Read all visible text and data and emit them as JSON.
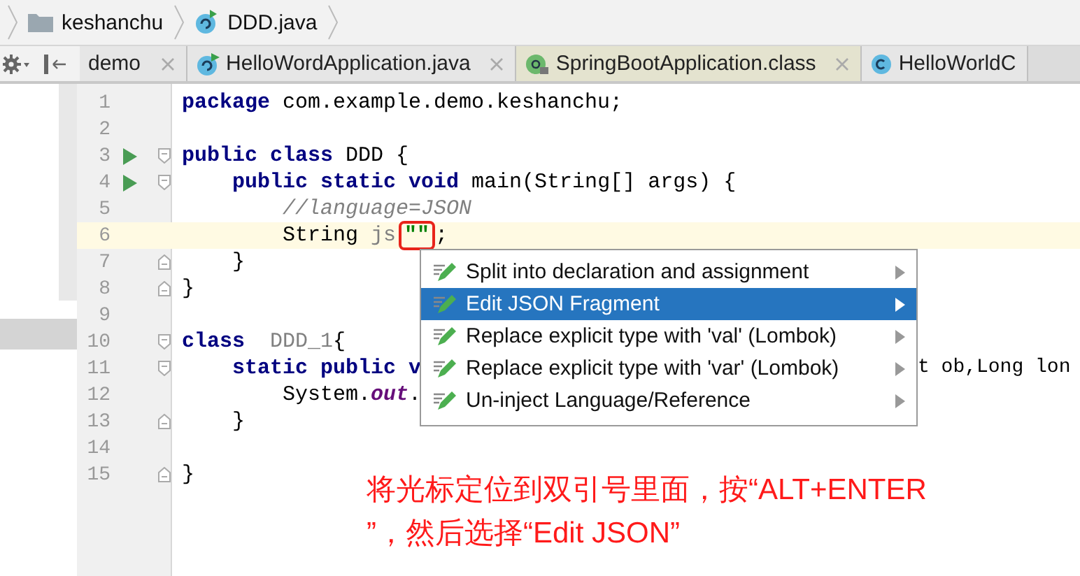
{
  "breadcrumb": [
    {
      "label": "keshanchu",
      "kind": "folder"
    },
    {
      "label": "DDD.java",
      "kind": "class"
    }
  ],
  "tabs": [
    {
      "label": "demo",
      "kind": "none",
      "color": "#e6e6e6"
    },
    {
      "label": "HelloWordApplication.java",
      "kind": "class-run",
      "color": "#e6e6e6"
    },
    {
      "label": "SpringBootApplication.class",
      "kind": "annotation",
      "color": "#e4e3cf"
    },
    {
      "label": "HelloWorldC",
      "kind": "class",
      "color": "#e6e6e6"
    }
  ],
  "lines": [
    {
      "number": "1",
      "tokens": [
        {
          "text": "package",
          "kind": "keyword"
        },
        {
          "text": " com.example.demo.keshanchu;",
          "kind": "plain"
        }
      ]
    },
    {
      "number": "2"
    },
    {
      "number": "3",
      "run": true,
      "fold_start": true,
      "tokens": [
        {
          "text": "public class",
          "kind": "keyword"
        },
        {
          "text": " DDD {",
          "kind": "plain"
        }
      ]
    },
    {
      "number": "4",
      "run": true,
      "fold_start": true,
      "tokens": [
        {
          "text": "    public static void",
          "kind": "keyword"
        },
        {
          "text": " main(String[] args) {",
          "kind": "plain"
        }
      ]
    },
    {
      "number": "5",
      "tokens": [
        {
          "text": "        //language=JSON",
          "kind": "comment"
        }
      ]
    },
    {
      "number": "6",
      "current": true,
      "tokens": [
        {
          "text": "        String ",
          "kind": "plain"
        },
        {
          "text": "js",
          "kind": "unused"
        },
        {
          "text": "\"\"",
          "kind": "marked"
        },
        {
          "text": ";",
          "kind": "plain"
        }
      ]
    },
    {
      "number": "7",
      "fold_end": true,
      "tokens": [
        {
          "text": "    }",
          "kind": "plain"
        }
      ]
    },
    {
      "number": "8",
      "fold_end": true,
      "tokens": [
        {
          "text": "}",
          "kind": "plain"
        }
      ]
    },
    {
      "number": "9"
    },
    {
      "number": "10",
      "fold_start": true,
      "tokens": [
        {
          "text": "class",
          "kind": "keyword"
        },
        {
          "text": "  DDD_1",
          "kind": "unused"
        },
        {
          "text": "{",
          "kind": "plain"
        }
      ]
    },
    {
      "number": "11",
      "fold_start": true,
      "tokens": [
        {
          "text": "    static public v",
          "kind": "keyword"
        }
      ],
      "after_popup": "t ob,Long lon"
    },
    {
      "number": "12",
      "tokens": [
        {
          "text": "        System.",
          "kind": "plain"
        },
        {
          "text": "out",
          "kind": "field"
        },
        {
          "text": ".",
          "kind": "plain"
        }
      ]
    },
    {
      "number": "13",
      "fold_end": true,
      "tokens": [
        {
          "text": "    }",
          "kind": "plain"
        }
      ]
    },
    {
      "number": "14"
    },
    {
      "number": "15",
      "fold_end": true,
      "tokens": [
        {
          "text": "}",
          "kind": "plain"
        }
      ]
    }
  ],
  "popup": {
    "items": [
      {
        "label": "Split into declaration and assignment",
        "selected": false
      },
      {
        "label": "Edit JSON Fragment",
        "selected": true
      },
      {
        "label": "Replace explicit type with 'val' (Lombok)",
        "selected": false
      },
      {
        "label": "Replace explicit type with 'var' (Lombok)",
        "selected": false
      },
      {
        "label": "Un-inject Language/Reference",
        "selected": false
      }
    ]
  },
  "note": {
    "lines": [
      "将光标定位到双引号里面，按“ALT+ENTER",
      "”，然后选择“Edit JSON”"
    ]
  }
}
